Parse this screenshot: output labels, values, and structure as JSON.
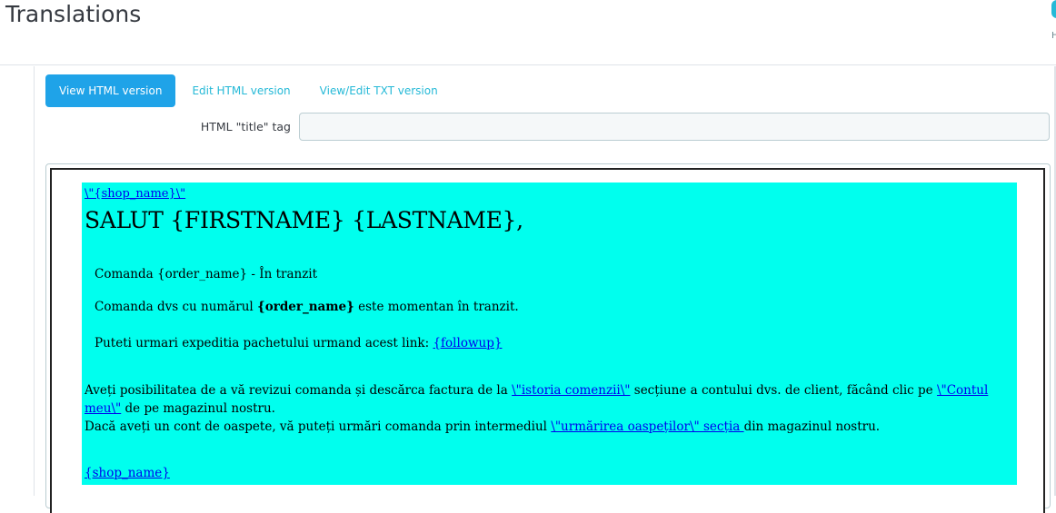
{
  "header": {
    "title": "Translations",
    "help_letter": "H"
  },
  "tabs": [
    {
      "label": "View HTML version",
      "active": true
    },
    {
      "label": "Edit HTML version",
      "active": false
    },
    {
      "label": "View/Edit TXT version",
      "active": false
    }
  ],
  "form": {
    "title_tag_label": "HTML \"title\" tag",
    "title_tag_value": ""
  },
  "colors": {
    "accent": "#25b9d7",
    "email_background": "#00ffee"
  },
  "email": {
    "shop_link_top": "\\\"{shop_name}\\\"",
    "greeting": "SALUT {FIRSTNAME} {LASTNAME},",
    "order_status": "Comanda {order_name} - În tranzit",
    "order_line_prefix": "Comanda dvs cu numărul ",
    "order_line_bold": "{order_name}",
    "order_line_suffix": " este momentan în tranzit.",
    "follow_prefix": "Puteti urmari expeditia pachetului urmand acest link: ",
    "follow_link": "{followup}",
    "review_1": "Aveți posibilitatea de a vă revizui comanda și descărca factura de la ",
    "review_link_history": "\\\"istoria comenzii\\\"",
    "review_2": " secțiune a contului dvs. de client, făcând clic pe ",
    "review_link_account": "\\\"Contul meu\\\"",
    "review_3": " de pe magazinul nostru.",
    "guest_1": "Dacă aveți un cont de oaspete, vă puteți urmări comanda prin intermediul ",
    "guest_link": "\\\"urmărirea oaspeților\\\" secția ",
    "guest_2": "din magazinul nostru.",
    "shop_link_bottom": "{shop_name}"
  }
}
